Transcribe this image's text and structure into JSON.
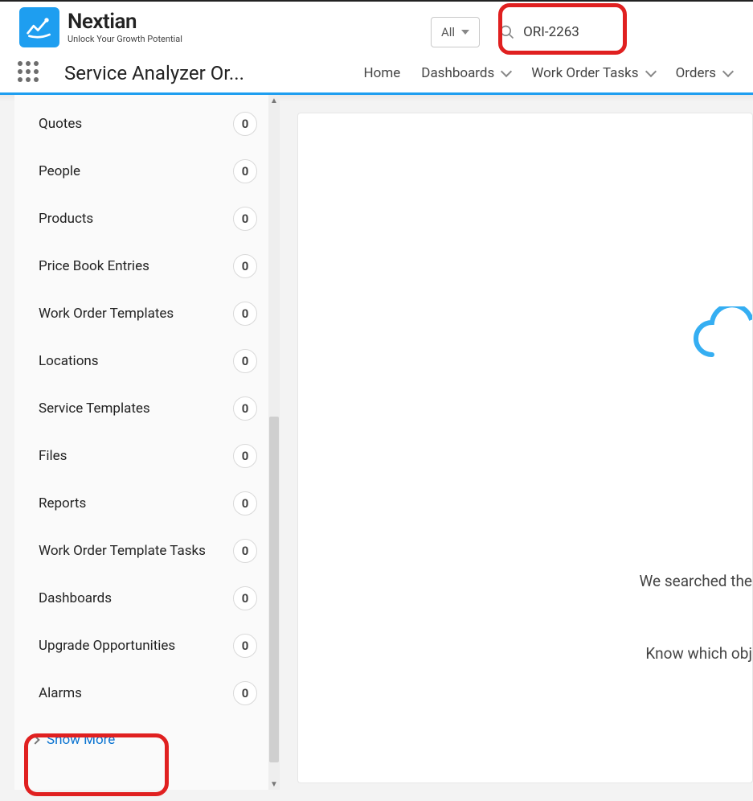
{
  "brand": {
    "name": "Nextian",
    "tagline": "Unlock Your Growth Potential"
  },
  "search": {
    "scope_label": "All",
    "value": "ORI-2263"
  },
  "app_title": "Service Analyzer Or...",
  "nav": [
    {
      "label": "Home",
      "has_menu": false
    },
    {
      "label": "Dashboards",
      "has_menu": true
    },
    {
      "label": "Work Order Tasks",
      "has_menu": true
    },
    {
      "label": "Orders",
      "has_menu": true
    }
  ],
  "sidebar": {
    "items": [
      {
        "label": "Quotes",
        "count": "0"
      },
      {
        "label": "People",
        "count": "0"
      },
      {
        "label": "Products",
        "count": "0"
      },
      {
        "label": "Price Book Entries",
        "count": "0"
      },
      {
        "label": "Work Order Templates",
        "count": "0"
      },
      {
        "label": "Locations",
        "count": "0"
      },
      {
        "label": "Service Templates",
        "count": "0"
      },
      {
        "label": "Files",
        "count": "0"
      },
      {
        "label": "Reports",
        "count": "0"
      },
      {
        "label": "Work Order Template Tasks",
        "count": "0"
      },
      {
        "label": "Dashboards",
        "count": "0"
      },
      {
        "label": "Upgrade Opportunities",
        "count": "0"
      },
      {
        "label": "Alarms",
        "count": "0"
      }
    ],
    "show_more": "Show More"
  },
  "main": {
    "message_line_1": "We searched the",
    "message_line_2": "Know which obj"
  },
  "accent_color": "#1e9ef0",
  "highlight_color": "#e02020"
}
